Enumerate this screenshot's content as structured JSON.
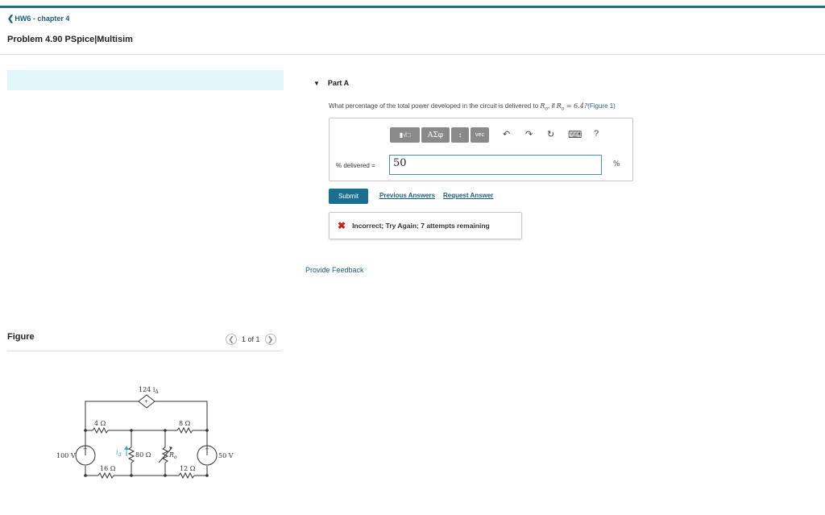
{
  "nav": {
    "back_label": "HW6 - chapter 4"
  },
  "problem": {
    "title": "Problem 4.90 PSpice|Multisim"
  },
  "figure": {
    "label": "Figure",
    "pager": "1 of 1",
    "circuit": {
      "dep_source": "124 i",
      "dep_sub": "Δ",
      "r4": "4 Ω",
      "r8": "8 Ω",
      "r80": "80 Ω",
      "r16": "16 Ω",
      "r12": "12 Ω",
      "ro": "R",
      "ro_sub": "o",
      "v100": "100 V",
      "v50": "50 V",
      "i_label": "i",
      "i_sub": "Δ",
      "plus": "+"
    }
  },
  "part": {
    "header": "Part A",
    "question_prefix": "What percentage of the total power developed in the circuit is delivered to ",
    "question_mid": ", if ",
    "question_eq": " = 6.4?",
    "r_sym": "R",
    "r_sub": "o",
    "figure_link": "(Figure 1)",
    "toolbar": {
      "templates": "▮√□",
      "symbols": "AΣφ",
      "arrows": "↕",
      "vec": "vec",
      "undo": "↶",
      "redo": "↷",
      "reset": "↻",
      "keyboard": "⌨",
      "help": "?"
    },
    "answer_label": "% delivered =",
    "answer_value": "50",
    "answer_unit": "%",
    "submit_label": "Submit",
    "previous_answers": "Previous Answers",
    "request_answer": "Request Answer",
    "feedback_message": "Incorrect; Try Again; 7 attempts remaining",
    "provide_feedback": "Provide Feedback"
  },
  "colors": {
    "accent": "#1a6f91",
    "error": "#c81e1e",
    "banner": "#e3f6f8"
  }
}
